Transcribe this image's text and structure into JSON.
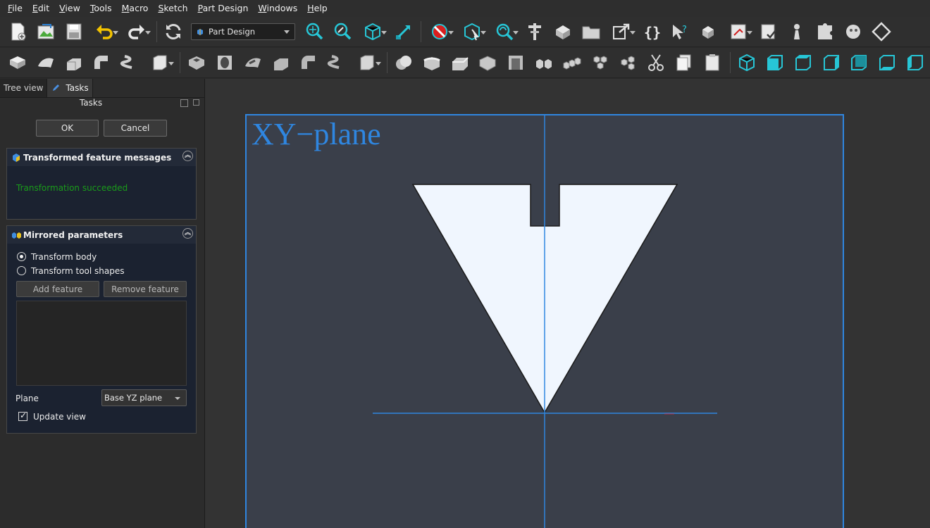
{
  "menubar": {
    "items": [
      {
        "label": "File",
        "accel": "F",
        "rest": "ile"
      },
      {
        "label": "Edit",
        "accel": "E",
        "rest": "dit"
      },
      {
        "label": "View",
        "accel": "V",
        "rest": "iew"
      },
      {
        "label": "Tools",
        "accel": "T",
        "rest": "ools"
      },
      {
        "label": "Macro",
        "accel": "M",
        "rest": "acro"
      },
      {
        "label": "Sketch",
        "accel": "S",
        "rest": "ketch"
      },
      {
        "label": "Part Design",
        "accel": "P",
        "rest": "art Design"
      },
      {
        "label": "Windows",
        "accel": "W",
        "rest": "indows"
      },
      {
        "label": "Help",
        "accel": "H",
        "rest": "elp"
      }
    ]
  },
  "toolbar": {
    "workbench": "Part Design"
  },
  "tabs": {
    "tree_view": "Tree view",
    "tasks": "Tasks"
  },
  "tasks_panel": {
    "title": "Tasks",
    "ok_label": "OK",
    "cancel_label": "Cancel"
  },
  "messages_box": {
    "title": "Transformed feature messages",
    "message": "Transformation succeeded",
    "message_color": "#1a9b1a"
  },
  "params_box": {
    "title": "Mirrored parameters",
    "radio_transform_body": "Transform body",
    "radio_transform_tools": "Transform tool shapes",
    "add_feature": "Add feature",
    "remove_feature": "Remove feature",
    "plane_label": "Plane",
    "plane_value": "Base YZ plane",
    "update_view": "Update view"
  },
  "viewport": {
    "plane_label": "XY−plane",
    "accent": "#2f86e0"
  }
}
